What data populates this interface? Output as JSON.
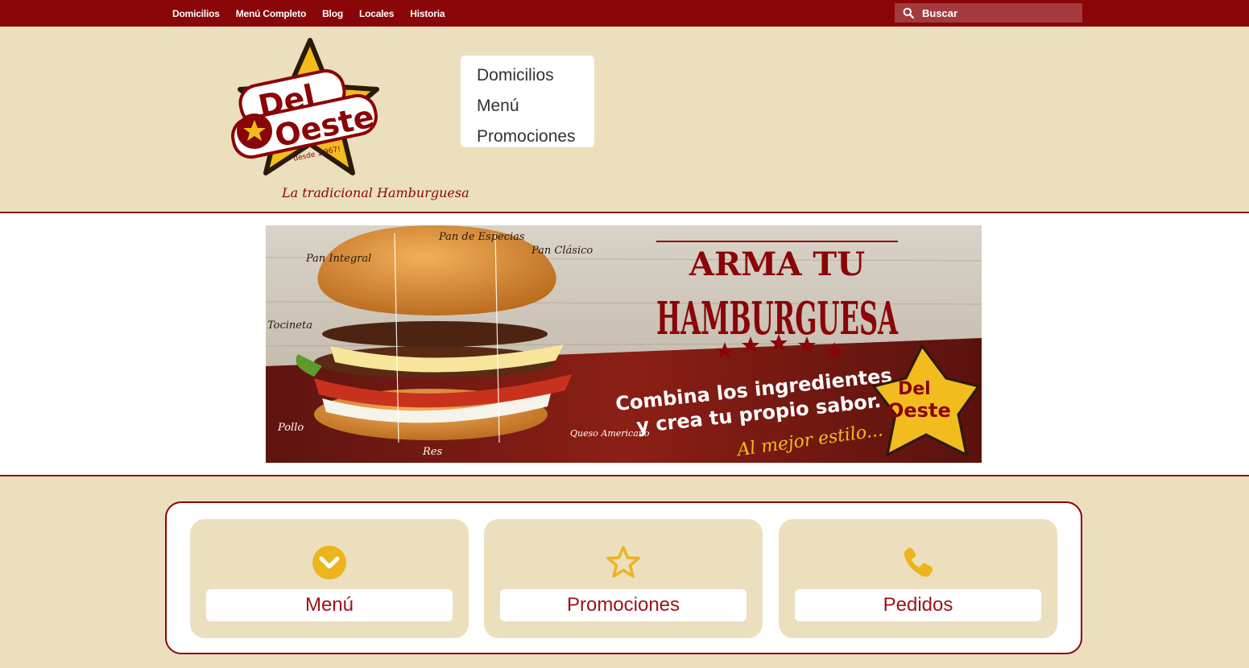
{
  "topnav": {
    "items": [
      "Domicilios",
      "Menú Completo",
      "Blog",
      "Locales",
      "Historia"
    ],
    "search_placeholder": "Buscar"
  },
  "logo": {
    "text_line1": "Del",
    "text_line2": "Oeste",
    "since": "desde 1.967!"
  },
  "tagline": "La tradicional Hamburguesa",
  "mainmenu": {
    "items": [
      "Domicilios",
      "Menú",
      "Promociones"
    ]
  },
  "banner": {
    "title_line1": "ARMA TU",
    "title_line2": "HAMBURGUESA",
    "subtitle_line1": "Combina los ingredientes",
    "subtitle_line2": "y crea tu propio sabor.",
    "slogan": "Al mejor estilo...",
    "ingredients": [
      "Pan Integral",
      "Pan de Especias",
      "Pan Clásico",
      "Tocineta",
      "Pollo",
      "Res",
      "Queso Americano"
    ]
  },
  "cards": [
    {
      "label": "Menú",
      "icon": "chevron-down-circle-icon"
    },
    {
      "label": "Promociones",
      "icon": "star-outline-icon"
    },
    {
      "label": "Pedidos",
      "icon": "phone-icon"
    }
  ],
  "colors": {
    "brand_red": "#8a0508",
    "cream": "#ebdfbe",
    "accent_yellow": "#ecb51d",
    "card_text": "#9d1217"
  }
}
